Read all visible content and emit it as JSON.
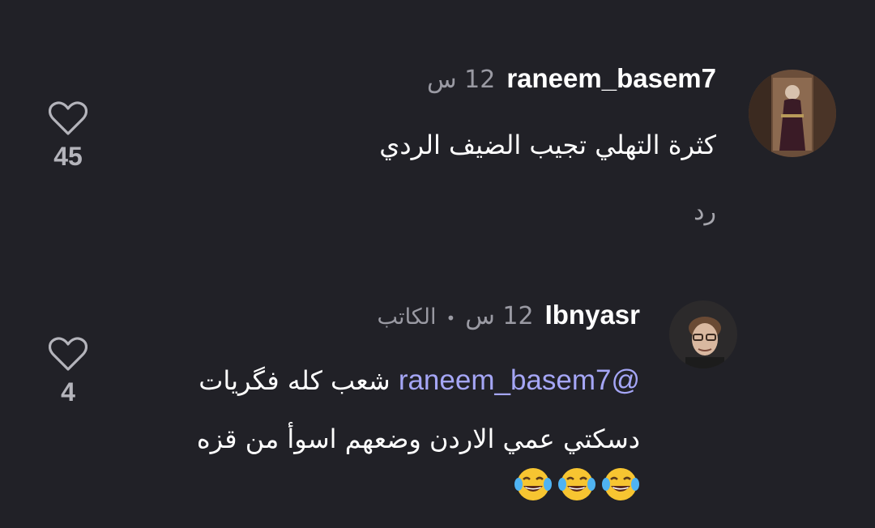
{
  "comments": [
    {
      "username": "raneem_basem7",
      "time": "12 س",
      "text": "كثرة التهلي تجيب الضيف الردي",
      "reply_label": "رد",
      "likes": "45",
      "avatar_icon": "user-photo-avatar"
    },
    {
      "username": "Ibnyasr",
      "time": "12 س",
      "separator": "•",
      "role": "الكاتب",
      "mention": "@raneem_basem7",
      "text_line1": "شعب كله فگريات",
      "text_line2": "دسكتي عمي الاردن وضعهم اسوأ من قزه",
      "emojis": [
        "laughing-tears-emoji",
        "laughing-tears-emoji",
        "laughing-tears-emoji"
      ],
      "likes": "4",
      "avatar_icon": "user-photo-avatar"
    }
  ],
  "colors": {
    "background": "#212127",
    "mention": "#a5a6f6",
    "secondary_text": "#9a9aa3"
  }
}
